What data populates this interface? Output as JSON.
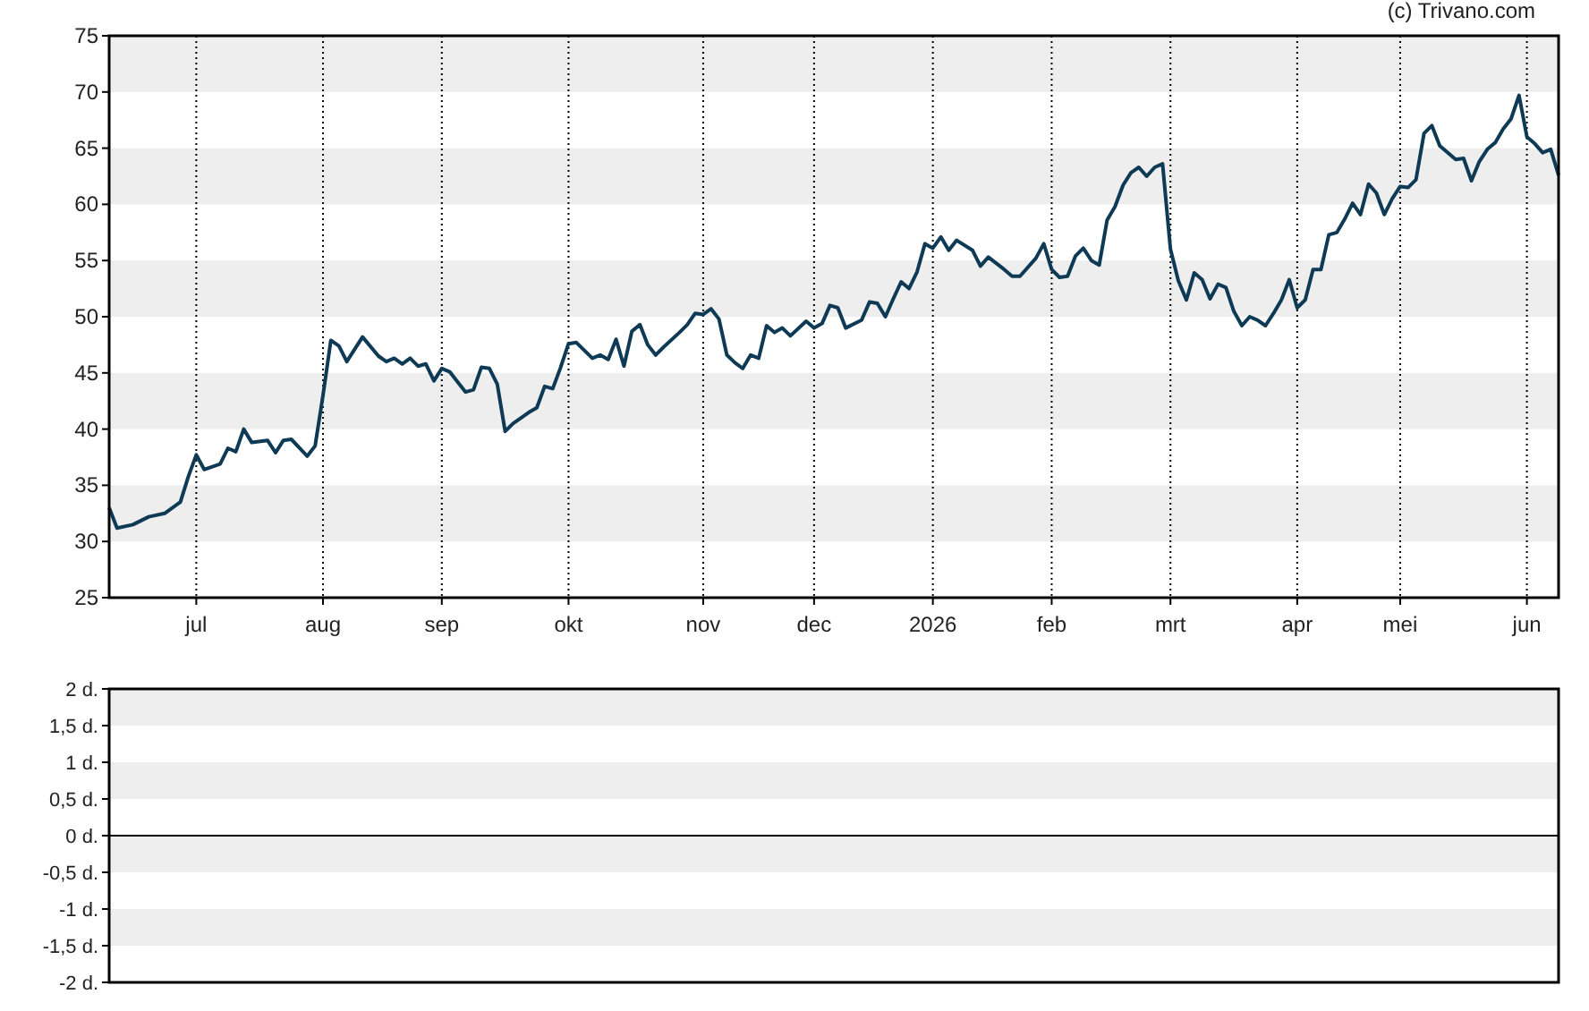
{
  "credit": "(c) Trivano.com",
  "price_chart": {
    "chart_data": {
      "type": "line",
      "ylim": [
        25,
        75
      ],
      "yticks": [
        25,
        30,
        35,
        40,
        45,
        50,
        55,
        60,
        65,
        70,
        75
      ],
      "categories": [
        null,
        null,
        null,
        null,
        null,
        null,
        null,
        null,
        null,
        null,
        null,
        "jul",
        null,
        null,
        null,
        null,
        null,
        null,
        null,
        null,
        null,
        null,
        null,
        null,
        null,
        null,
        null,
        "aug",
        null,
        null,
        null,
        null,
        null,
        null,
        null,
        null,
        null,
        null,
        null,
        null,
        null,
        null,
        "sep",
        null,
        null,
        null,
        null,
        null,
        null,
        null,
        null,
        null,
        null,
        null,
        null,
        null,
        null,
        null,
        "okt",
        null,
        null,
        null,
        null,
        null,
        null,
        null,
        null,
        null,
        null,
        null,
        null,
        null,
        null,
        null,
        null,
        "nov",
        null,
        null,
        null,
        null,
        null,
        null,
        null,
        null,
        null,
        null,
        null,
        null,
        null,
        "dec",
        null,
        null,
        null,
        null,
        null,
        null,
        null,
        null,
        null,
        null,
        null,
        null,
        null,
        null,
        "2026",
        null,
        null,
        null,
        null,
        null,
        null,
        null,
        null,
        null,
        null,
        null,
        null,
        null,
        null,
        "feb",
        null,
        null,
        null,
        null,
        null,
        null,
        null,
        null,
        null,
        null,
        null,
        null,
        null,
        null,
        "mrt",
        null,
        null,
        null,
        null,
        null,
        null,
        null,
        null,
        null,
        null,
        null,
        null,
        null,
        null,
        null,
        "apr",
        null,
        null,
        null,
        null,
        null,
        null,
        null,
        null,
        null,
        null,
        null,
        null,
        "mei",
        null,
        null,
        null,
        null,
        null,
        null,
        null,
        null,
        null,
        null,
        null,
        null,
        null,
        null,
        null,
        "jun",
        null,
        null,
        null,
        null
      ],
      "series": [
        {
          "color": "#0e3a56",
          "values": [
            33,
            31.2,
            null,
            31.5,
            null,
            32.2,
            null,
            32.5,
            null,
            33.5,
            35.8,
            37.7,
            36.4,
            null,
            36.9,
            38.3,
            38,
            40,
            38.8,
            null,
            39,
            37.9,
            39,
            39.1,
            null,
            37.6,
            38.5,
            43,
            47.9,
            47.4,
            46,
            47.1,
            48.2,
            null,
            46.5,
            46,
            46.3,
            45.8,
            46.3,
            45.6,
            45.8,
            44.3,
            45.4,
            45.1,
            null,
            43.3,
            43.5,
            45.5,
            45.4,
            44,
            39.8,
            40.5,
            null,
            41.5,
            41.9,
            43.8,
            43.6,
            45.5,
            47.6,
            47.7,
            null,
            46.3,
            46.6,
            46.2,
            48,
            45.6,
            48.7,
            49.3,
            47.5,
            46.6,
            47.3,
            null,
            48.6,
            49.3,
            50.3,
            50.2,
            50.7,
            49.8,
            46.6,
            45.9,
            45.4,
            46.6,
            46.3,
            49.2,
            48.6,
            49,
            48.3,
            null,
            49.6,
            49,
            49.4,
            51,
            50.8,
            49,
            null,
            49.7,
            51.3,
            51.2,
            50,
            51.6,
            53.1,
            52.5,
            54,
            56.5,
            56.1,
            57.1,
            55.9,
            56.8,
            null,
            55.9,
            54.5,
            55.3,
            null,
            54.2,
            53.6,
            53.6,
            null,
            55.2,
            56.5,
            54.2,
            53.5,
            53.6,
            55.4,
            56.1,
            55,
            54.6,
            58.6,
            59.8,
            61.7,
            62.8,
            63.3,
            62.5,
            63.3,
            63.6,
            56,
            53.2,
            51.5,
            53.9,
            53.3,
            51.6,
            52.9,
            52.6,
            50.5,
            49.2,
            50,
            49.7,
            49.2,
            50.3,
            51.5,
            53.3,
            50.8,
            51.5,
            54.2,
            54.2,
            57.3,
            57.5,
            58.7,
            60.1,
            59.1,
            61.8,
            61,
            59.1,
            60.5,
            61.6,
            61.5,
            62.2,
            66.3,
            67,
            65.2,
            64.6,
            64,
            64.1,
            62.1,
            63.8,
            64.9,
            65.5,
            66.7,
            67.6,
            69.7,
            66,
            65.4,
            64.6,
            64.9,
            62.6
          ]
        }
      ]
    }
  },
  "indicator_chart": {
    "chart_data": {
      "type": "line",
      "ylim": [
        -2,
        2
      ],
      "categories": [
        null,
        null
      ],
      "yticks": [
        {
          "value": 2,
          "label": "2 d."
        },
        {
          "value": 1.5,
          "label": "1,5 d."
        },
        {
          "value": 1,
          "label": "1 d."
        },
        {
          "value": 0.5,
          "label": "0,5 d."
        },
        {
          "value": 0,
          "label": "0 d."
        },
        {
          "value": -0.5,
          "label": "-0,5 d."
        },
        {
          "value": -1,
          "label": "-1 d."
        },
        {
          "value": -1.5,
          "label": "-1,5 d."
        },
        {
          "value": -2,
          "label": "-2 d."
        }
      ]
    }
  }
}
